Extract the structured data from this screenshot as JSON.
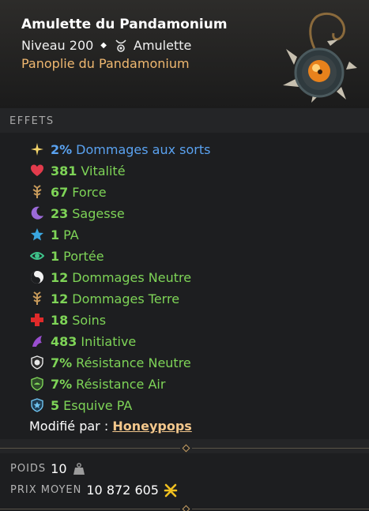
{
  "item": {
    "name": "Amulette du Pandamonium",
    "level_text": "Niveau 200",
    "type": "Amulette",
    "set": "Panoplie du Pandamonium",
    "image_icon": "pandamonium-amulet-image"
  },
  "effects_title": "EFFETS",
  "effects": [
    {
      "icon": "sparkle-icon",
      "value": "2%",
      "label": "Dommages aux sorts",
      "color": "#5aa2f0"
    },
    {
      "icon": "heart-icon",
      "value": "381",
      "label": "Vitalité",
      "color": "#7ed457"
    },
    {
      "icon": "force-icon",
      "value": "67",
      "label": "Force",
      "color": "#7ed457"
    },
    {
      "icon": "moon-icon",
      "value": "23",
      "label": "Sagesse",
      "color": "#7ed457"
    },
    {
      "icon": "star-icon",
      "value": "1",
      "label": "PA",
      "color": "#7ed457"
    },
    {
      "icon": "eye-icon",
      "value": "1",
      "label": "Portée",
      "color": "#7ed457"
    },
    {
      "icon": "yin-yang-icon",
      "value": "12",
      "label": "Dommages Neutre",
      "color": "#7ed457"
    },
    {
      "icon": "earth-icon",
      "value": "12",
      "label": "Dommages Terre",
      "color": "#7ed457"
    },
    {
      "icon": "red-cross-icon",
      "value": "18",
      "label": "Soins",
      "color": "#7ed457"
    },
    {
      "icon": "initiative-icon",
      "value": "483",
      "label": "Initiative",
      "color": "#7ed457"
    },
    {
      "icon": "shield-neutral-icon",
      "value": "7%",
      "label": "Résistance Neutre",
      "color": "#7ed457"
    },
    {
      "icon": "shield-air-icon",
      "value": "7%",
      "label": "Résistance Air",
      "color": "#7ed457"
    },
    {
      "icon": "shield-pa-icon",
      "value": "5",
      "label": "Esquive PA",
      "color": "#7ed457"
    }
  ],
  "modified": {
    "label": "Modifié par :",
    "crafter": "Honeypops"
  },
  "weight": {
    "label": "POIDS",
    "value": "10",
    "icon": "weight-icon"
  },
  "price": {
    "label": "PRIX MOYEN",
    "value": "10 872 605",
    "icon": "kamas-icon"
  }
}
